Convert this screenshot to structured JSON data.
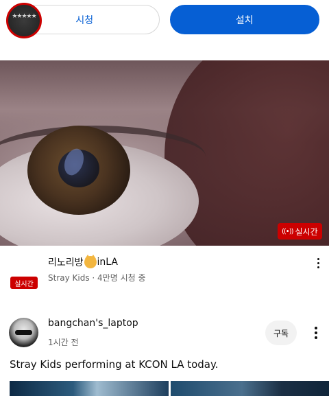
{
  "top_buttons": {
    "watch_label": "시청",
    "install_label": "설치"
  },
  "video": {
    "live_badge": "실시간"
  },
  "channel": {
    "name": "리노리방",
    "name_suffix": "inLA",
    "meta": "Stray Kids · 4만명 시청 중",
    "live_label": "실시간",
    "avatar_stars": "★★★★★"
  },
  "post": {
    "author": "bangchan's_laptop",
    "time": "1시간 전",
    "subscribe_label": "구독",
    "text": "Stray Kids performing at KCON LA today."
  },
  "colors": {
    "accent": "#065fd4",
    "live": "#cc0000"
  }
}
